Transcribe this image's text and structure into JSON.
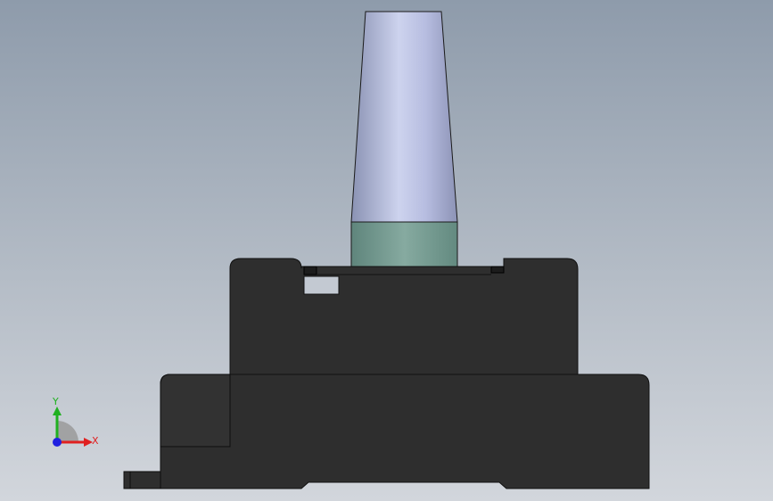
{
  "viewport": {
    "background_top": "#8e9bab",
    "background_bottom": "#d2d6dc"
  },
  "model": {
    "cone_color_light": "#c7cde8",
    "cone_color_dark": "#9098b8",
    "collar_color": "#7a9f95",
    "body_color": "#2e2e2e",
    "edge_color": "#000000"
  },
  "triad": {
    "x_label": "X",
    "y_label": "Y",
    "x_color": "#e02020",
    "y_color": "#20b020",
    "z_color": "#2020e0"
  }
}
